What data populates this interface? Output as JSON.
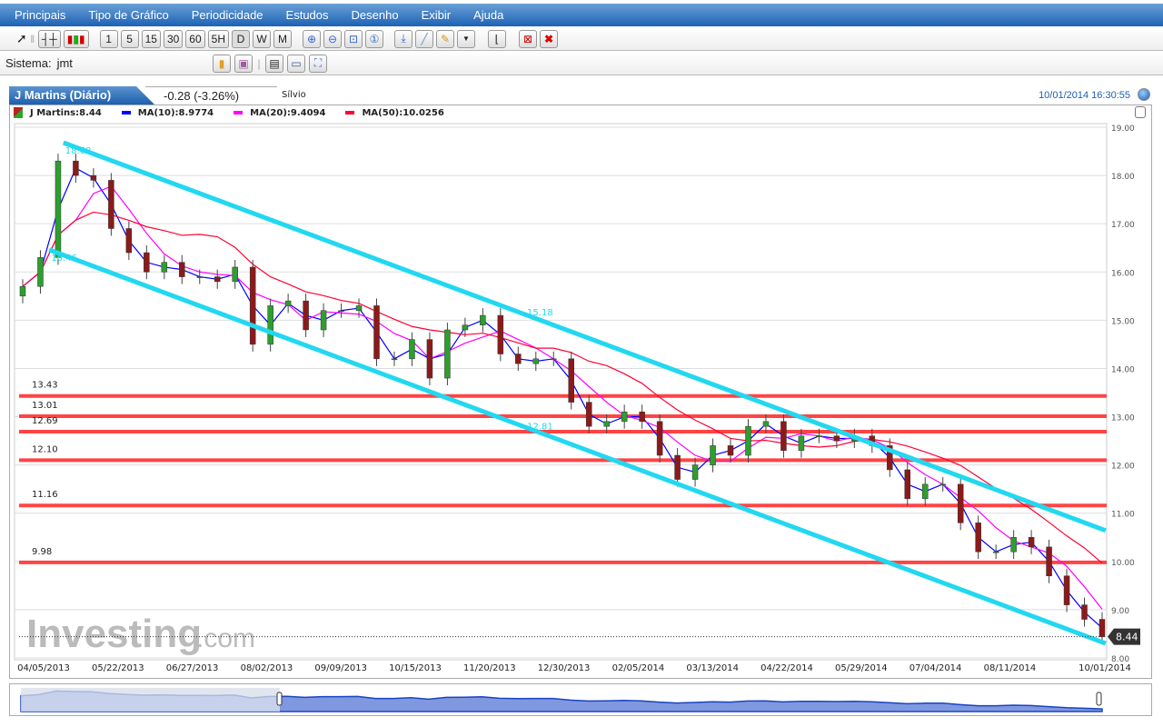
{
  "menu": [
    "Principais",
    "Tipo de Gráfico",
    "Periodicidade",
    "Estudos",
    "Desenho",
    "Exibir",
    "Ajuda"
  ],
  "toolbar": {
    "periods": [
      "1",
      "5",
      "15",
      "30",
      "60",
      "5H",
      "D",
      "W",
      "M"
    ],
    "active_period": "D"
  },
  "system": {
    "label": "Sistema:",
    "value": "jmt"
  },
  "tabs": {
    "main": "J Martins (Diário)",
    "change": "-0.28 (-3.26%)",
    "other": "Sílvio"
  },
  "timestamp": "10/01/2014 16:30:55",
  "legend": [
    {
      "label": "J Martins:8.44",
      "color": "#8b1a1a"
    },
    {
      "label": "MA(10):8.9774",
      "color": "#0000ff"
    },
    {
      "label": "MA(20):9.4094",
      "color": "#ff00ff"
    },
    {
      "label": "MA(50):10.0256",
      "color": "#ff0033"
    }
  ],
  "watermark": "Investing.com",
  "chart_data": {
    "type": "candlestick",
    "ylim": [
      8,
      19
    ],
    "yticks": [
      "19.00",
      "18.00",
      "17.00",
      "16.00",
      "15.00",
      "14.00",
      "13.00",
      "12.00",
      "11.00",
      "10.00",
      "9.00",
      "8.00"
    ],
    "xticks": [
      "04/05/2013",
      "05/22/2013",
      "06/27/2013",
      "08/02/2013",
      "09/09/2013",
      "10/15/2013",
      "11/20/2013",
      "12/30/2013",
      "02/05/2014",
      "03/13/2014",
      "04/22/2014",
      "05/29/2014",
      "07/04/2014",
      "08/11/2014",
      "10/01/2014"
    ],
    "closes": [
      15.7,
      16.3,
      18.3,
      18.0,
      17.9,
      16.9,
      16.4,
      16.0,
      16.2,
      15.9,
      15.9,
      15.8,
      16.1,
      14.5,
      15.3,
      15.4,
      14.8,
      15.2,
      15.2,
      15.3,
      14.2,
      14.2,
      14.6,
      13.8,
      14.8,
      14.9,
      15.1,
      14.3,
      14.1,
      14.2,
      14.2,
      13.3,
      12.8,
      12.9,
      13.1,
      12.9,
      12.2,
      11.7,
      12.0,
      12.4,
      12.2,
      12.8,
      12.9,
      12.3,
      12.6,
      12.6,
      12.5,
      12.6,
      12.4,
      11.9,
      11.3,
      11.6,
      11.6,
      10.8,
      10.2,
      10.2,
      10.5,
      10.3,
      9.7,
      9.1,
      8.8,
      8.44
    ],
    "last_price": "8.44",
    "horizontal_levels": [
      {
        "value": 13.43,
        "label": "13.43"
      },
      {
        "value": 13.01,
        "label": "13.01"
      },
      {
        "value": 12.69,
        "label": "12.69"
      },
      {
        "value": 12.1,
        "label": "12.10"
      },
      {
        "value": 11.16,
        "label": "11.16"
      },
      {
        "value": 9.98,
        "label": "9.98"
      }
    ],
    "channel": [
      {
        "from": [
          2.3,
          18.68
        ],
        "to": [
          61.2,
          10.64
        ],
        "label": "18.68"
      },
      {
        "from": [
          1.5,
          16.46
        ],
        "to": [
          61.2,
          8.3
        ],
        "label": "16.46"
      }
    ],
    "channel_labels": [
      {
        "t": 28.5,
        "value": 15.18,
        "label": "15.18"
      },
      {
        "t": 28.5,
        "value": 12.81,
        "label": "12.81"
      }
    ],
    "series_colors": {
      "up": "#2e9e2e",
      "down": "#8b1a1a",
      "channel": "#22d8f0",
      "level": "#ff4444"
    }
  }
}
